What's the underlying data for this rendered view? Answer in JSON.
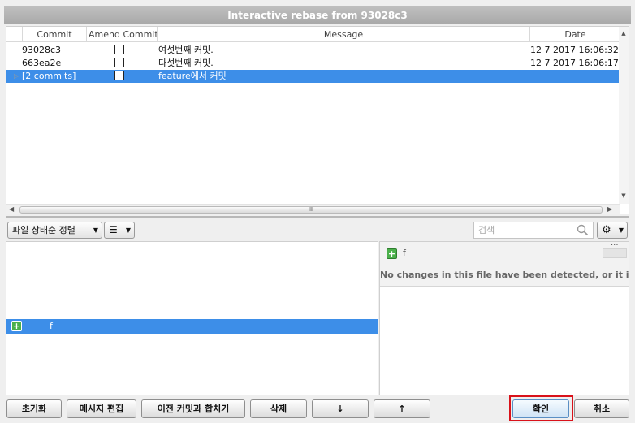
{
  "window": {
    "title": "Interactive rebase from 93028c3"
  },
  "commit_table": {
    "columns": {
      "commit": "Commit",
      "amend": "Amend Commit",
      "message": "Message",
      "date": "Date"
    },
    "rows": [
      {
        "commit": "93028c3",
        "message": "여섯번째 커밋.",
        "date": "12 7 2017 16:06:32",
        "selected": false,
        "amend_checked": false
      },
      {
        "commit": "663ea2e",
        "message": "다섯번째 커밋.",
        "date": "12 7 2017 16:06:17",
        "selected": false,
        "amend_checked": false
      },
      {
        "commit": "[2 commits]",
        "message": "feature에서 커밋",
        "date": "",
        "selected": true,
        "amend_checked": false
      }
    ],
    "hscroll_label": "III"
  },
  "file_toolbar": {
    "sort_label": "파일 상태순 정렬",
    "search_placeholder": "검색"
  },
  "file_list": {
    "selected_file": "f"
  },
  "diff": {
    "file_name": "f",
    "dots": "...",
    "message": "No changes in this file have been detected, or it is a binary file."
  },
  "buttons": {
    "reset": "초기화",
    "edit_message": "메시지 편집",
    "squash": "이전 커밋과 합치기",
    "delete": "삭제",
    "down": "↓",
    "up": "↑",
    "ok": "확인",
    "cancel": "취소"
  },
  "colors": {
    "selection": "#3d8ee8",
    "highlight_border": "#d9121a",
    "add_icon": "#4bb04b"
  }
}
